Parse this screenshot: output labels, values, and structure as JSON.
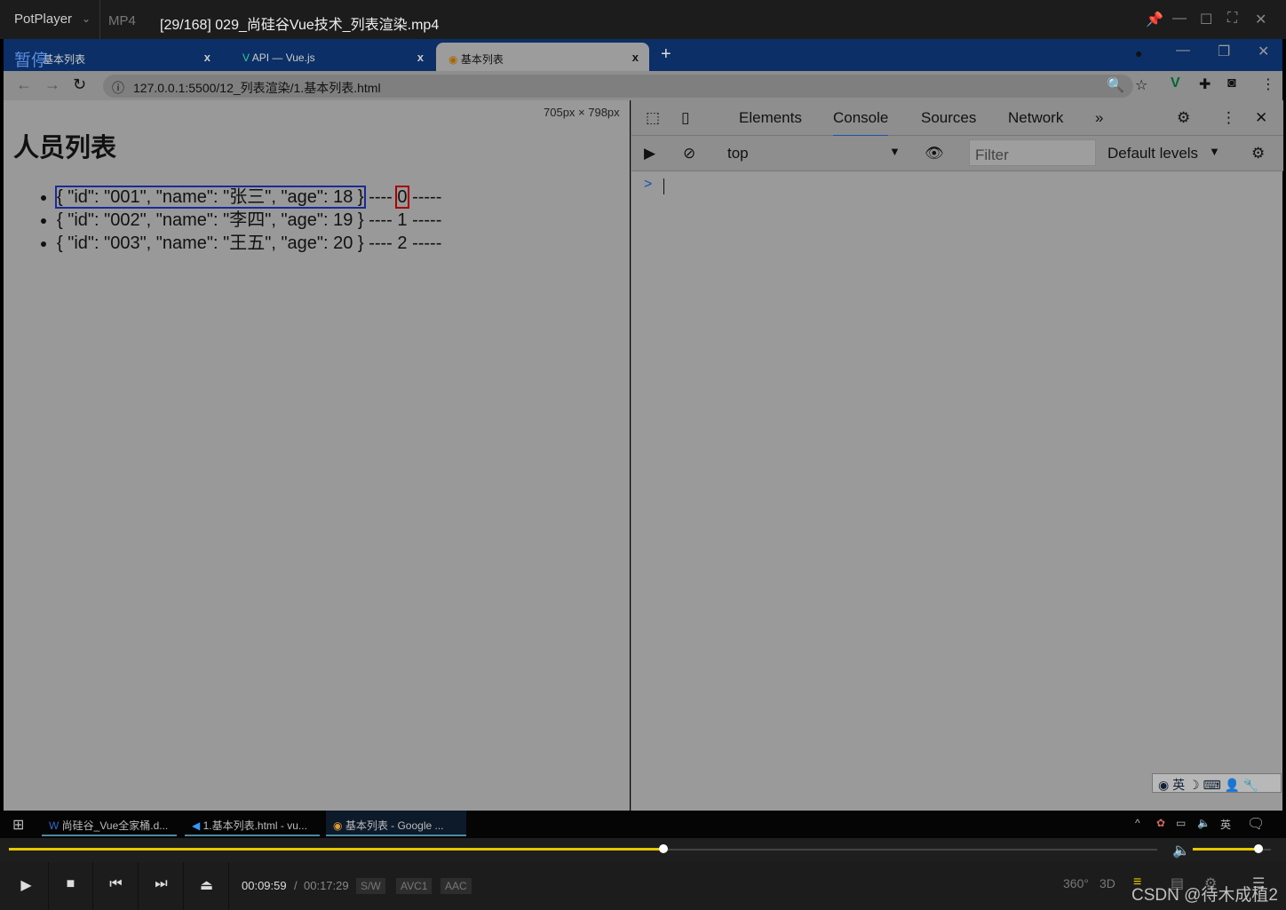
{
  "player": {
    "brand": "PotPlayer",
    "format": "MP4",
    "title": "[29/168] 029_尚硅谷Vue技术_列表渲染.mp4",
    "status_overlay": "暂停",
    "time_current": "00:09:59",
    "time_total": "00:17:29",
    "badges": [
      "S/W",
      "AVC1",
      "AAC"
    ],
    "progress_percent": 57,
    "volume_percent": 84,
    "watermark": "CSDN @待木成植2",
    "accent": "#e8c800"
  },
  "browser": {
    "tabs": [
      {
        "label": "基本列表",
        "active": false
      },
      {
        "label": "API — Vue.js",
        "active": false
      },
      {
        "label": "基本列表",
        "active": true
      }
    ],
    "url": "127.0.0.1:5500/12_列表渲染/1.基本列表.html",
    "viewport_dims": "705px × 798px"
  },
  "page": {
    "heading": "人员列表",
    "items": [
      {
        "json": "{ \"id\": \"001\", \"name\": \"张三\", \"age\": 18 }",
        "sep": "----",
        "index": "0",
        "tail": "-----"
      },
      {
        "json": "{ \"id\": \"002\", \"name\": \"李四\", \"age\": 19 }",
        "sep": "----",
        "index": "1",
        "tail": "-----"
      },
      {
        "json": "{ \"id\": \"003\", \"name\": \"王五\", \"age\": 20 }",
        "sep": "----",
        "index": "2",
        "tail": "-----"
      }
    ]
  },
  "devtools": {
    "tabs": [
      "Elements",
      "Console",
      "Sources",
      "Network"
    ],
    "active_tab": "Console",
    "context": "top",
    "filter_placeholder": "Filter",
    "levels": "Default levels",
    "prompt": ">"
  },
  "ime": {
    "lang": "英"
  },
  "taskbar": {
    "items": [
      "尚硅谷_Vue全家桶.d...",
      "1.基本列表.html - vu...",
      "基本列表 - Google ..."
    ],
    "tray_lang": "英"
  }
}
